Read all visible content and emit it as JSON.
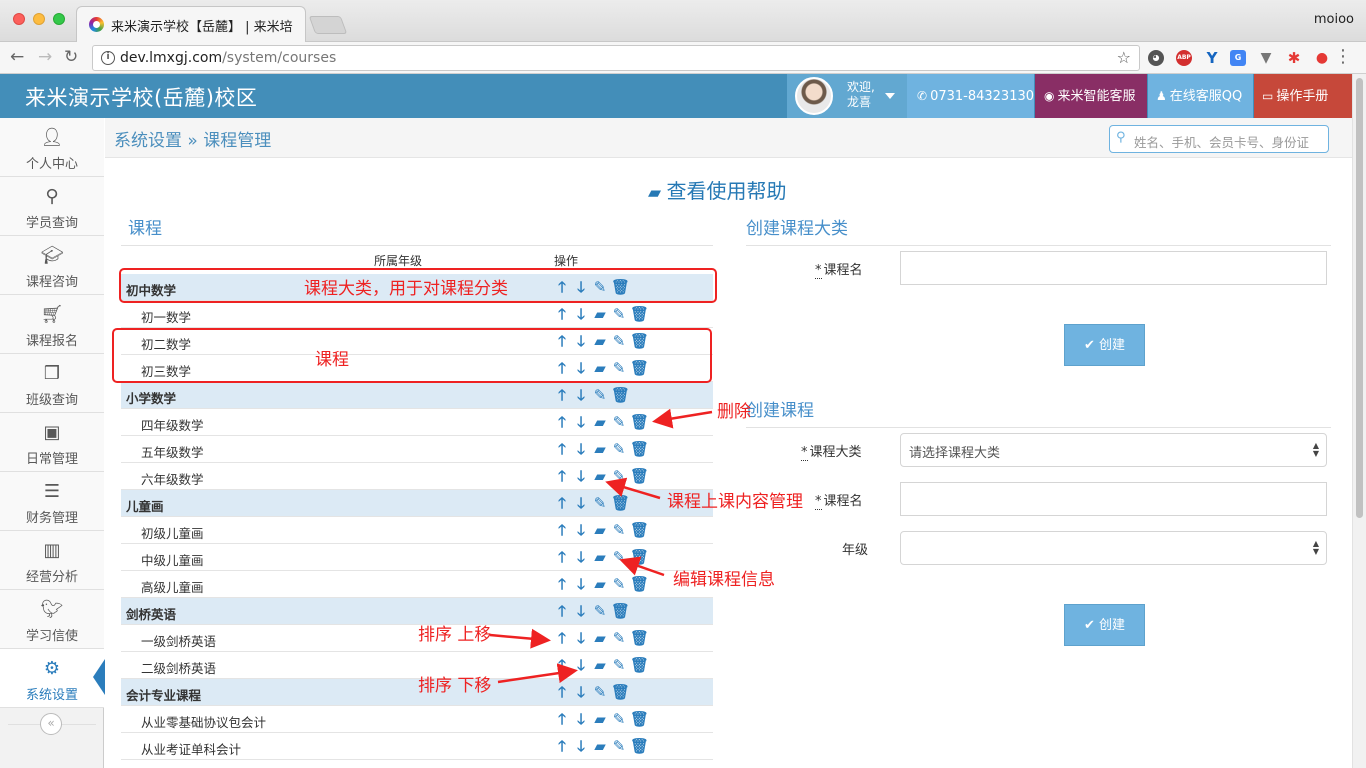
{
  "browser": {
    "tab_title": "来米演示学校【岳麓】 | 来米培",
    "url_host": "dev.lmxgj.com",
    "url_path": "/system/courses",
    "window_user": "moioo"
  },
  "header": {
    "brand": "来米演示学校(岳麓)校区",
    "welcome": "欢迎,",
    "username": "龙喜",
    "phone": "0731-84323130",
    "kefu": "来米智能客服",
    "qq": "在线客服QQ",
    "manual": "操作手册"
  },
  "sidebar": {
    "items": [
      {
        "label": "个人中心",
        "icon": "user-icon"
      },
      {
        "label": "学员查询",
        "icon": "search-icon"
      },
      {
        "label": "课程咨询",
        "icon": "graduation-cap-icon"
      },
      {
        "label": "课程报名",
        "icon": "cart-icon"
      },
      {
        "label": "班级查询",
        "icon": "cubes-icon"
      },
      {
        "label": "日常管理",
        "icon": "slideshare-icon"
      },
      {
        "label": "财务管理",
        "icon": "list-icon"
      },
      {
        "label": "经营分析",
        "icon": "bar-chart-icon"
      },
      {
        "label": "学习信使",
        "icon": "twitter-icon"
      },
      {
        "label": "系统设置",
        "icon": "cogs-icon",
        "active": true
      }
    ],
    "collapse": "«"
  },
  "breadcrumb": {
    "text": "系统设置 » 课程管理"
  },
  "search": {
    "placeholder": "姓名、手机、会员卡号、身份证"
  },
  "help": {
    "title": "查看使用帮助"
  },
  "courses": {
    "section_title": "课程",
    "col_grade": "所属年级",
    "col_ops": "操作",
    "rows": [
      {
        "name": "初中数学",
        "type": "category"
      },
      {
        "name": "初一数学",
        "type": "course"
      },
      {
        "name": "初二数学",
        "type": "course"
      },
      {
        "name": "初三数学",
        "type": "course"
      },
      {
        "name": "小学数学",
        "type": "category"
      },
      {
        "name": "四年级数学",
        "type": "course"
      },
      {
        "name": "五年级数学",
        "type": "course"
      },
      {
        "name": "六年级数学",
        "type": "course"
      },
      {
        "name": "儿童画",
        "type": "category"
      },
      {
        "name": "初级儿童画",
        "type": "course"
      },
      {
        "name": "中级儿童画",
        "type": "course"
      },
      {
        "name": "高级儿童画",
        "type": "course"
      },
      {
        "name": "剑桥英语",
        "type": "category"
      },
      {
        "name": "一级剑桥英语",
        "type": "course"
      },
      {
        "name": "二级剑桥英语",
        "type": "course"
      },
      {
        "name": "会计专业课程",
        "type": "category"
      },
      {
        "name": "从业零基础协议包会计",
        "type": "course"
      },
      {
        "name": "从业考证单科会计",
        "type": "course"
      }
    ]
  },
  "create_category": {
    "title": "创建课程大类",
    "label_name": "课程名",
    "submit": "创建"
  },
  "create_course": {
    "title": "创建课程",
    "label_category": "课程大类",
    "category_placeholder": "请选择课程大类",
    "label_name": "课程名",
    "label_grade": "年级",
    "submit": "创建"
  },
  "annotations": {
    "category": "课程大类，用于对课程分类",
    "course": "课程",
    "delete": "删除",
    "content": "课程上课内容管理",
    "edit": "编辑课程信息",
    "move_up": "排序 上移",
    "move_down": "排序 下移"
  },
  "colors": {
    "header": "#438eb9",
    "accent": "#2b7dbc",
    "annotation": "#ee2222"
  }
}
